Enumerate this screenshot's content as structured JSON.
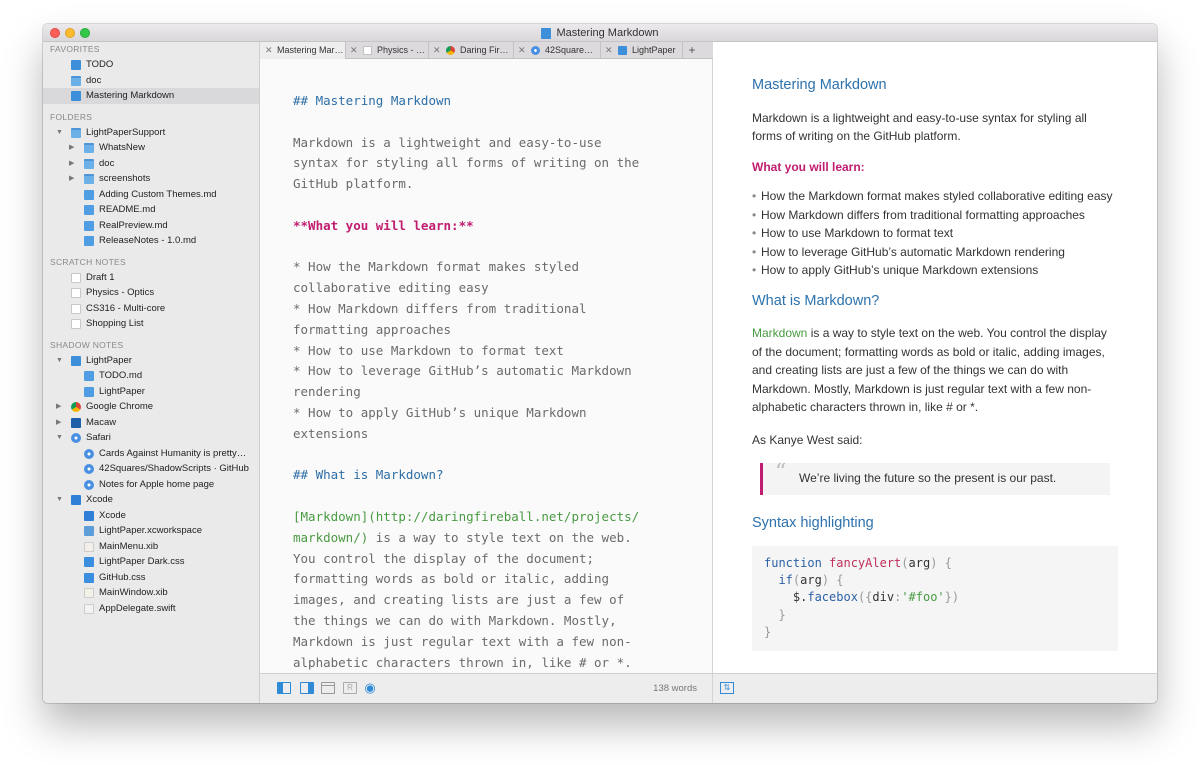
{
  "window": {
    "title": "Mastering Markdown"
  },
  "sidebar": {
    "sections": [
      {
        "title": "FAVORITES",
        "items": [
          {
            "label": "TODO",
            "icon": "doc-icon",
            "indent": 1,
            "disclosure": ""
          },
          {
            "label": "doc",
            "icon": "folder-icon",
            "indent": 1,
            "disclosure": ""
          },
          {
            "label": "Mastering Markdown",
            "icon": "doc-icon",
            "indent": 1,
            "disclosure": "",
            "selected": true
          }
        ]
      },
      {
        "title": "FOLDERS",
        "items": [
          {
            "label": "LightPaperSupport",
            "icon": "folder-icon",
            "indent": 1,
            "disclosure": "▼"
          },
          {
            "label": "WhatsNew",
            "icon": "folder-icon",
            "indent": 2,
            "disclosure": "▶"
          },
          {
            "label": "doc",
            "icon": "folder-icon",
            "indent": 2,
            "disclosure": "▶"
          },
          {
            "label": "screenshots",
            "icon": "folder-icon",
            "indent": 2,
            "disclosure": "▶"
          },
          {
            "label": "Adding Custom Themes.md",
            "icon": "md-file-icon",
            "indent": 2,
            "disclosure": ""
          },
          {
            "label": "README.md",
            "icon": "md-file-icon",
            "indent": 2,
            "disclosure": ""
          },
          {
            "label": "RealPreview.md",
            "icon": "md-file-icon",
            "indent": 2,
            "disclosure": ""
          },
          {
            "label": "ReleaseNotes - 1.0.md",
            "icon": "md-file-icon",
            "indent": 2,
            "disclosure": ""
          }
        ]
      },
      {
        "title": "SCRATCH NOTES",
        "items": [
          {
            "label": "Draft 1",
            "icon": "blank-doc-icon",
            "indent": 1,
            "disclosure": ""
          },
          {
            "label": "Physics - Optics",
            "icon": "blank-doc-icon",
            "indent": 1,
            "disclosure": ""
          },
          {
            "label": "CS316 - Multi-core",
            "icon": "blank-doc-icon",
            "indent": 1,
            "disclosure": ""
          },
          {
            "label": "Shopping List",
            "icon": "blank-doc-icon",
            "indent": 1,
            "disclosure": ""
          }
        ]
      },
      {
        "title": "SHADOW NOTES",
        "items": [
          {
            "label": "LightPaper",
            "icon": "doc-icon",
            "indent": 1,
            "disclosure": "▼"
          },
          {
            "label": "TODO.md",
            "icon": "md-file-icon",
            "indent": 2,
            "disclosure": ""
          },
          {
            "label": "LightPaper",
            "icon": "md-file-icon",
            "indent": 2,
            "disclosure": ""
          },
          {
            "label": "Google Chrome",
            "icon": "chrome-icon",
            "indent": 1,
            "disclosure": "▶"
          },
          {
            "label": "Macaw",
            "icon": "macaw-icon",
            "indent": 1,
            "disclosure": "▶"
          },
          {
            "label": "Safari",
            "icon": "safari-icon",
            "indent": 1,
            "disclosure": "▼"
          },
          {
            "label": "Cards Against Humanity is pretty…",
            "icon": "safari-icon",
            "indent": 2,
            "disclosure": ""
          },
          {
            "label": "42Squares/ShadowScripts · GitHub",
            "icon": "safari-icon",
            "indent": 2,
            "disclosure": ""
          },
          {
            "label": "Notes for Apple home page",
            "icon": "safari-icon",
            "indent": 2,
            "disclosure": ""
          },
          {
            "label": "Xcode",
            "icon": "xcode-icon",
            "indent": 1,
            "disclosure": "▼"
          },
          {
            "label": "Xcode",
            "icon": "xcode-icon",
            "indent": 2,
            "disclosure": ""
          },
          {
            "label": "LightPaper.xcworkspace",
            "icon": "workspace-icon",
            "indent": 2,
            "disclosure": ""
          },
          {
            "label": "MainMenu.xib",
            "icon": "xib-icon",
            "indent": 2,
            "disclosure": ""
          },
          {
            "label": "LightPaper Dark.css",
            "icon": "css-icon",
            "indent": 2,
            "disclosure": ""
          },
          {
            "label": "GitHub.css",
            "icon": "css-icon",
            "indent": 2,
            "disclosure": ""
          },
          {
            "label": "MainWindow.xib",
            "icon": "xib-icon",
            "indent": 2,
            "disclosure": ""
          },
          {
            "label": "AppDelegate.swift",
            "icon": "swift-icon",
            "indent": 2,
            "disclosure": ""
          }
        ]
      }
    ]
  },
  "tabs": [
    {
      "label": "Mastering Mar…",
      "icon": "",
      "active": true
    },
    {
      "label": "Physics - …",
      "icon": "blank-doc-icon",
      "active": false
    },
    {
      "label": "Daring Fir…",
      "icon": "chrome-icon",
      "active": false
    },
    {
      "label": "42Square…",
      "icon": "safari-icon",
      "active": false
    },
    {
      "label": "LightPaper",
      "icon": "doc-icon",
      "active": false
    }
  ],
  "tab_add_label": "+",
  "editor": {
    "h_mastering": "## Mastering Markdown",
    "intro": [
      "Markdown is a lightweight and easy-to-use",
      "syntax for styling all forms of writing on the",
      "GitHub platform."
    ],
    "learn": "**What you will learn:**",
    "bullets": [
      "* How the Markdown format makes styled",
      "collaborative editing easy",
      "* How Markdown differs from traditional",
      "formatting approaches",
      "* How to use Markdown to format text",
      "* How to leverage GitHub’s automatic Markdown",
      "rendering",
      "* How to apply GitHub’s unique Markdown",
      "extensions"
    ],
    "h_what": "## What is Markdown?",
    "link1": "[Markdown](http://daringfireball.net/projects/",
    "link2": "markdown/)",
    "link2_rest": " is a way to style text on the web.",
    "body": [
      "You control the display of the document;",
      "formatting words as bold or italic, adding",
      "images, and creating lists are just a few of",
      "the things we can do with Markdown. Mostly,",
      "Markdown is just regular text with a few non-",
      "alphabetic characters thrown in, like # or *."
    ]
  },
  "editor_status": {
    "word_count": "138 words",
    "r_label": "R"
  },
  "preview": {
    "title": "Mastering Markdown",
    "intro": "Markdown is a lightweight and easy-to-use syntax for styling all forms of writing on the GitHub platform.",
    "learn": "What you will learn:",
    "bullets": [
      "How the Markdown format makes styled collaborative editing easy",
      "How Markdown differs from traditional formatting approaches",
      "How to use Markdown to format text",
      "How to leverage GitHub’s automatic Markdown rendering",
      "How to apply GitHub’s unique Markdown extensions"
    ],
    "h_what": "What is Markdown?",
    "what_link": "Markdown",
    "what_text": " is a way to style text on the web. You control the display of the document; formatting words as bold or italic, adding images, and creating lists are just a few of the things we can do with Markdown. Mostly, Markdown is just regular text with a few non-alphabetic characters thrown in, like # or *.",
    "kanye": "As Kanye West said:",
    "quote": "We’re living the future so the present is our past.",
    "h_syntax": "Syntax highlighting"
  },
  "colors": {
    "accent": "#2d72ad",
    "bold_pink": "#c01c70",
    "link_green": "#4a9a43"
  }
}
